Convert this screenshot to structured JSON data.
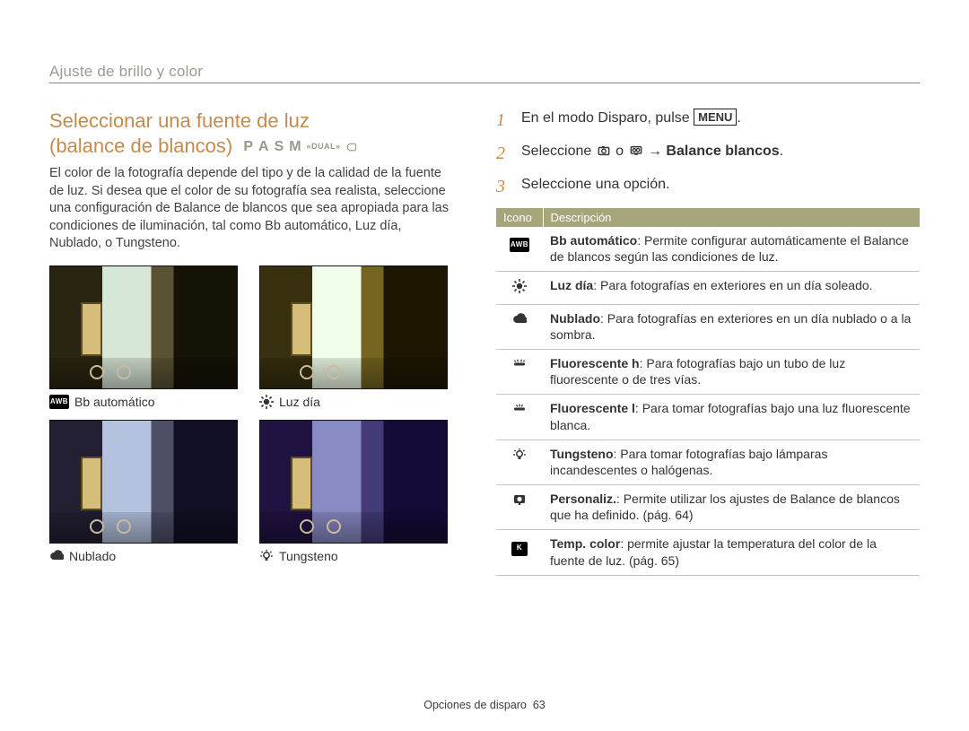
{
  "header": {
    "section_title": "Ajuste de brillo y color"
  },
  "title": {
    "line1": "Seleccionar una fuente de luz",
    "line2_prefix": "(balance de blancos)",
    "modes": [
      "P",
      "A",
      "S",
      "M"
    ],
    "modes_extra": "DUAL"
  },
  "intro": "El color de la fotografía depende del tipo y de la calidad de la fuente de luz. Si desea que el color de su fotografía sea realista, seleccione una configuración de Balance de blancos que sea apropiada para las condiciones de iluminación, tal como Bb automático, Luz día, Nublado, o Tungsteno.",
  "thumbs": [
    {
      "icon": "awb",
      "label": "Bb automático"
    },
    {
      "icon": "sun",
      "label": "Luz día"
    },
    {
      "icon": "cloud",
      "label": "Nublado"
    },
    {
      "icon": "bulb",
      "label": "Tungsteno"
    }
  ],
  "steps": {
    "s1_pre": "En el modo Disparo, pulse ",
    "s1_menu": "MENU",
    "s1_post": ".",
    "s2_pre": "Seleccione ",
    "s2_mid": " o ",
    "s2_arrow": " → ",
    "s2_bold": "Balance blancos",
    "s2_post": ".",
    "s3": "Seleccione una opción."
  },
  "table": {
    "head_icon": "Icono",
    "head_desc": "Descripción",
    "rows": [
      {
        "icon": "awb",
        "term": "Bb automático",
        "desc": ": Permite configurar automáticamente el Balance de blancos según las condiciones de luz."
      },
      {
        "icon": "sun",
        "term": "Luz día",
        "desc": ": Para fotografías en exteriores en un día soleado."
      },
      {
        "icon": "cloud",
        "term": "Nublado",
        "desc": ": Para fotografías en exteriores en un día nublado o a la sombra."
      },
      {
        "icon": "fluoh",
        "term": "Fluorescente h",
        "desc": ": Para fotografías bajo un tubo de luz fluorescente o de tres vías."
      },
      {
        "icon": "fluol",
        "term": "Fluorescente l",
        "desc": ": Para tomar fotografías bajo una luz fluorescente blanca."
      },
      {
        "icon": "bulb",
        "term": "Tungsteno",
        "desc": ": Para tomar fotografías bajo lámparas incandescentes o halógenas."
      },
      {
        "icon": "custom",
        "term": "Personaliz.",
        "desc": ": Permite utilizar los ajustes de Balance de blancos que ha definido. (pág. 64)"
      },
      {
        "icon": "k",
        "term": "Temp. color",
        "desc": ": permite ajustar la temperatura del color de la fuente de luz. (pág. 65)"
      }
    ]
  },
  "footer": {
    "label": "Opciones de disparo",
    "page": "63"
  }
}
